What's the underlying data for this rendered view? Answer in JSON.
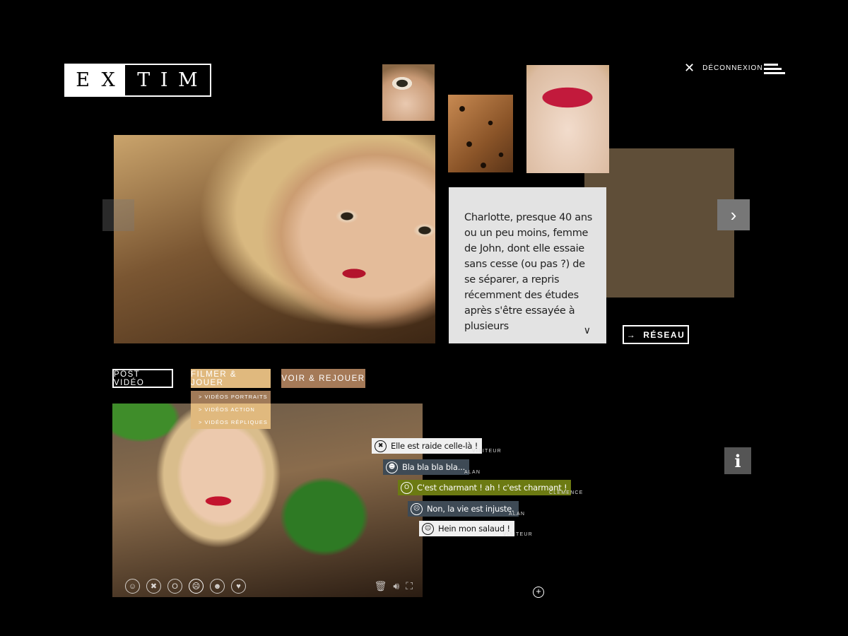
{
  "logo": {
    "letters": [
      "E",
      "X",
      "T",
      "I",
      "M"
    ]
  },
  "header": {
    "logout_label": "DÉCONNEXION",
    "menu_icon": "hamburger-icon"
  },
  "bio": {
    "text": "Charlotte, presque 40 ans ou un peu moins, femme de John, dont elle essaie sans cesse (ou pas ?) de se séparer, a repris récemment des études après s'être essayée à plusieurs"
  },
  "reseau": {
    "label": "RÉSEAU"
  },
  "tabs": [
    {
      "label": "POST VIDÉO"
    },
    {
      "label": "FILMER & JOUER"
    },
    {
      "label": "VOIR & REJOUER"
    }
  ],
  "submenu": [
    {
      "label": "> VIDÉOS PORTRAITS"
    },
    {
      "label": "> VIDÉOS ACTION"
    },
    {
      "label": "> VIDÉOS RÉPLIQUES"
    }
  ],
  "comments": [
    {
      "text": "Elle est raide celle-là !",
      "author": "VISITEUR",
      "icon": "annoyed-face-icon"
    },
    {
      "text": "Bla bla bla bla...",
      "author": "ALAN",
      "icon": "grin-face-icon"
    },
    {
      "text": "C'est charmant ! ah ! c'est charmant !",
      "author": "CLÉMENCE",
      "icon": "surprised-face-icon"
    },
    {
      "text": "Non, la vie est injuste.",
      "author": "ALAN",
      "icon": "sad-face-icon"
    },
    {
      "text": "Hein mon salaud !",
      "author": "VISITEUR",
      "icon": "smile-face-icon"
    }
  ],
  "colors": {
    "filmer": "#e0b97e",
    "voir": "#a57a58",
    "brown_block": "#5f4e38",
    "comment_green": "#6c7a12",
    "comment_slate": "#3e4a55"
  }
}
